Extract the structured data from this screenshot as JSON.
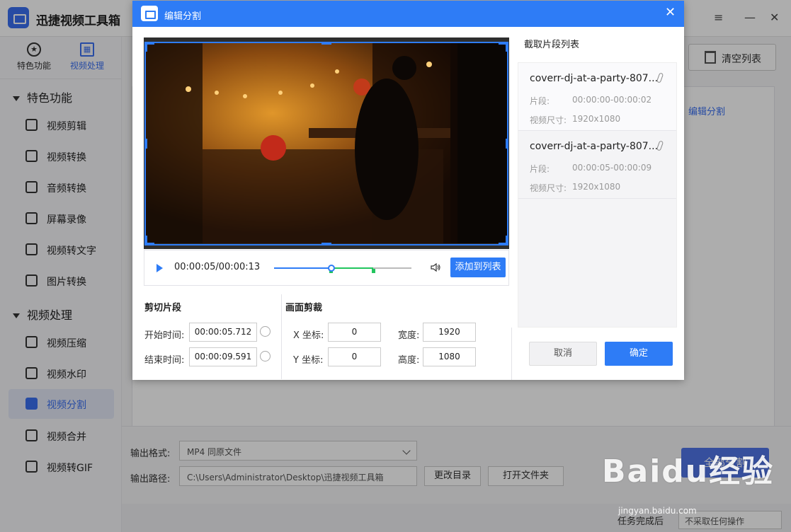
{
  "app": {
    "title": "迅捷视频工具箱",
    "window_controls": [
      "≡",
      "—",
      "✕"
    ]
  },
  "sidebar": {
    "switch": [
      {
        "label": "特色功能",
        "icon": "star-icon"
      },
      {
        "label": "视频处理",
        "icon": "film-icon"
      }
    ],
    "sections": [
      {
        "label": "特色功能"
      },
      {
        "label": "视频处理"
      }
    ],
    "items": [
      {
        "label": "视频剪辑",
        "icon": "crop-icon"
      },
      {
        "label": "视频转换",
        "icon": "convert-icon"
      },
      {
        "label": "音频转换",
        "icon": "audio-wave-icon"
      },
      {
        "label": "屏幕录像",
        "icon": "screen-record-icon"
      },
      {
        "label": "视频转文字",
        "icon": "text-icon"
      },
      {
        "label": "图片转换",
        "icon": "image-icon"
      },
      {
        "label": "视频压缩",
        "icon": "compress-icon"
      },
      {
        "label": "视频水印",
        "icon": "watermark-icon"
      },
      {
        "label": "视频分割",
        "icon": "split-icon"
      },
      {
        "label": "视频合并",
        "icon": "merge-icon"
      },
      {
        "label": "视频转GIF",
        "icon": "gif-icon"
      }
    ]
  },
  "main": {
    "clear_list": "清空列表",
    "row_action": "编辑分割",
    "output_format_label": "输出格式:",
    "output_format_value": "MP4  同原文件",
    "output_path_label": "输出路径:",
    "output_path_value": "C:\\Users\\Administrator\\Desktop\\迅捷视频工具箱",
    "change_dir": "更改目录",
    "open_folder": "打开文件夹",
    "split_all": "全部分割",
    "after_done_label": "任务完成后",
    "after_done_value": "不采取任何操作"
  },
  "dialog": {
    "title": "编辑分割",
    "close": "✕",
    "player": {
      "time": "00:00:05/00:00:13",
      "progress": 0.42,
      "range_start": 0.42,
      "range_end": 0.72,
      "add_to_list": "添加到列表"
    },
    "cut": {
      "heading": "剪切片段",
      "start_label": "开始时间:",
      "start_value": "00:00:05.712",
      "end_label": "结束时间:",
      "end_value": "00:00:09.591"
    },
    "crop": {
      "heading": "画面剪裁",
      "x_label": "X 坐标:",
      "x_value": "0",
      "y_label": "Y 坐标:",
      "y_value": "0",
      "w_label": "宽度:",
      "w_value": "1920",
      "h_label": "高度:",
      "h_value": "1080"
    },
    "list_title": "截取片段列表",
    "segments": [
      {
        "name": "coverr-dj-at-a-party-807...",
        "seg_label": "片段:",
        "seg_value": "00:00:00-00:00:02",
        "size_label": "视频尺寸:",
        "size_value": "1920x1080"
      },
      {
        "name": "coverr-dj-at-a-party-807...",
        "seg_label": "片段:",
        "seg_value": "00:00:05-00:00:09",
        "size_label": "视频尺寸:",
        "size_value": "1920x1080"
      }
    ],
    "cancel": "取消",
    "confirm": "确定"
  },
  "watermark": {
    "brand": "Baidu经验",
    "url": "jingyan.baidu.com"
  },
  "colors": {
    "accent": "#2e7cf6",
    "range": "#22c55e"
  }
}
